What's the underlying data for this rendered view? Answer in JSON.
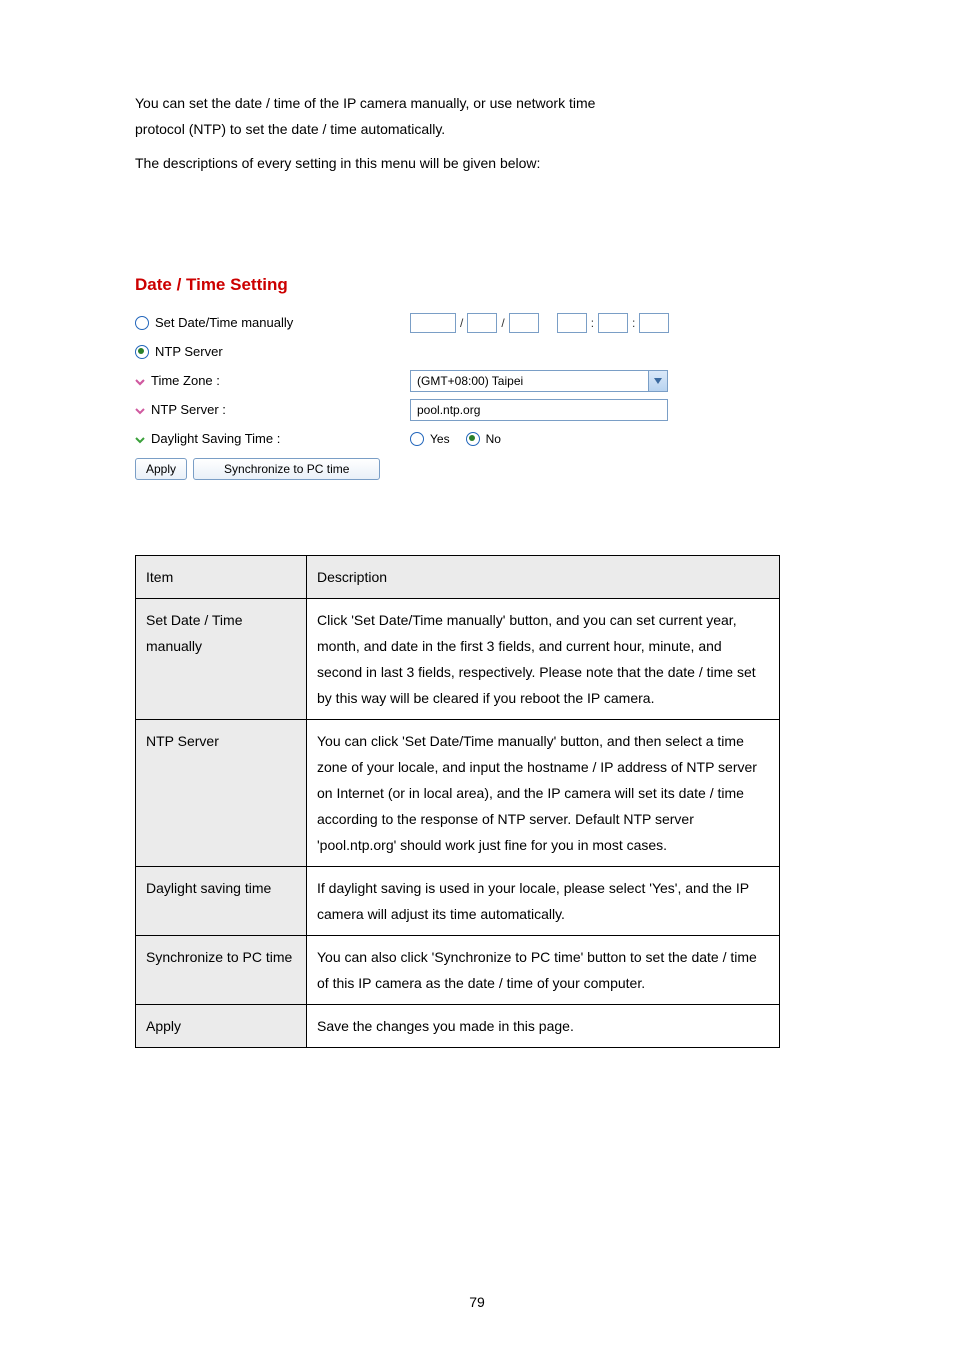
{
  "lead": {
    "line1": "You can set the date / time of the IP camera manually, or use network time",
    "line2": "protocol (NTP) to set the date / time automatically.",
    "sentence2": "The descriptions of every setting in this menu will be given below:"
  },
  "panel": {
    "title": "Date / Time Setting",
    "set_manually_label": "Set Date/Time manually",
    "ntp_server_label": "NTP Server",
    "timezone_label": "Time Zone :",
    "ntp_server_field_label": "NTP Server :",
    "dst_label": "Daylight Saving Time :",
    "timezone_value": "(GMT+08:00) Taipei",
    "ntp_server_value": "pool.ntp.org",
    "yes_label": "Yes",
    "no_label": "No",
    "apply_label": "Apply",
    "sync_label": "Synchronize to PC time"
  },
  "table": {
    "header_item": "Item",
    "header_desc": "Description",
    "rows": [
      {
        "item": "Set Date / Time manually",
        "desc": "Click 'Set Date/Time manually' button, and you can set current year, month, and date in the first 3 fields, and current hour, minute, and second in last 3 fields, respectively. Please note that the date / time set by this way will be cleared if you reboot the IP camera."
      },
      {
        "item": "NTP Server",
        "desc": "You can click 'Set Date/Time manually' button, and then select a time zone of your locale, and input the hostname / IP address of NTP server on Internet (or in local area), and the IP camera will set its date / time according to the response of NTP server. Default NTP server 'pool.ntp.org' should work just fine for you in most cases."
      },
      {
        "item": "Daylight saving time",
        "desc": "If daylight saving is used in your locale, please select 'Yes', and the IP camera will adjust its time automatically."
      },
      {
        "item": "Synchronize to PC time",
        "desc": "You can also click 'Synchronize to PC time' button to set the date / time of this IP camera as the date / time of your computer."
      },
      {
        "item": "Apply",
        "desc": "Save the changes you made in this page."
      }
    ]
  },
  "page_number": "79"
}
